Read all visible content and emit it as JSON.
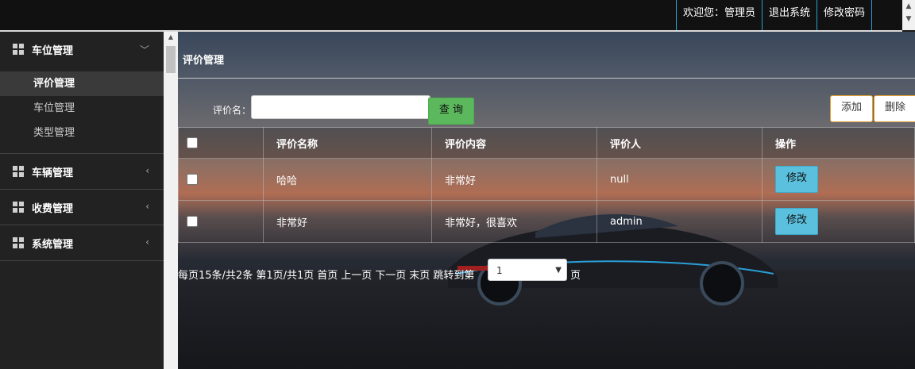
{
  "header": {
    "welcome": "欢迎您：管理员",
    "logout": "退出系统",
    "change_password": "修改密码"
  },
  "sidebar": {
    "groups": [
      {
        "label": "车位管理",
        "expanded": true,
        "items": [
          {
            "label": "评价管理",
            "active": true
          },
          {
            "label": "车位管理"
          },
          {
            "label": "类型管理"
          }
        ]
      },
      {
        "label": "车辆管理",
        "expanded": false
      },
      {
        "label": "收费管理",
        "expanded": false
      },
      {
        "label": "系统管理",
        "expanded": false
      }
    ]
  },
  "main": {
    "title": "评价管理",
    "search": {
      "label": "评价名：",
      "value": "",
      "placeholder": ""
    },
    "query_button": "查 询",
    "add_button": "添加",
    "delete_button": "删除",
    "table": {
      "headers": [
        "评价名称",
        "评价内容",
        "评价人",
        "操作"
      ],
      "rows": [
        {
          "name": "哈哈",
          "content": "非常好",
          "user": "null",
          "action": "修改"
        },
        {
          "name": "非常好",
          "content": "非常好，很喜欢",
          "user": "admin",
          "action": "修改"
        }
      ]
    },
    "pager": {
      "summary": "每页15条/共2条 第1页/共1页",
      "first": "首页",
      "prev": "上一页",
      "next": "下一页",
      "last": "末页",
      "jump_label": "跳转到第",
      "page_value": "1",
      "suffix": "页"
    }
  }
}
